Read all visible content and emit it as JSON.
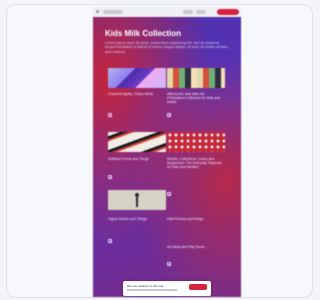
{
  "page": {
    "title": "Kids Milk Collection",
    "description": "Lorem ipsum dolor sit amet, consectetur adipiscing elit, sed do eiusmod tempor incididunt ut labore et dolore magna aliqua. Ut enim ad minim veniam, quis nostrud."
  },
  "tiles": [
    {
      "label": "Coloured Spells, Chaos Mode"
    },
    {
      "label": "Afterwords, and other Art Printmakers Collection for Kids and Adults"
    },
    {
      "label": "Outlined Forms and Things"
    },
    {
      "label": "Stories, Collections, Colors and Sequences: The Everyday Playbook for Kids and Families"
    },
    {
      "label": "Figure Stories and Things"
    },
    {
      "label": "Kids Pictures and things"
    },
    {
      "label": "Art Ideas and Play Room"
    }
  ],
  "cookie": {
    "text": "We use cookies on this site"
  },
  "colors": {
    "accent": "#d8223f",
    "background_start": "#4b2fa8",
    "background_end": "#7b2c86"
  }
}
